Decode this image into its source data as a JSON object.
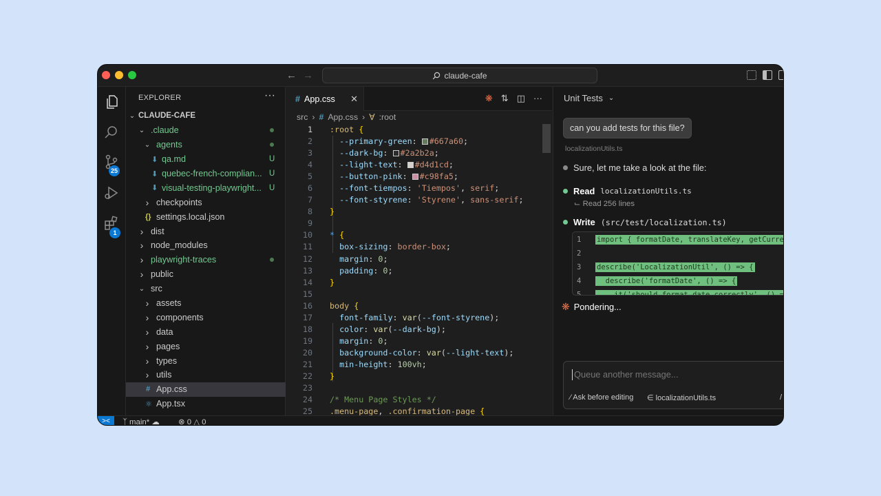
{
  "window": {
    "search_text": "claude-cafe"
  },
  "activity_bar": {
    "scm_badge": "25",
    "extensions_badge": "1"
  },
  "sidebar": {
    "title": "EXPLORER",
    "more": "···",
    "project": "CLAUDE-CAFE",
    "items": [
      {
        "label": ".claude",
        "indent": 1,
        "kind": "folder-open",
        "status": "dot",
        "color": "green"
      },
      {
        "label": "agents",
        "indent": 2,
        "kind": "folder-open",
        "status": "dot",
        "color": "green"
      },
      {
        "label": "qa.md",
        "indent": 3,
        "kind": "md",
        "status": "U",
        "color": "green"
      },
      {
        "label": "quebec-french-complian...",
        "indent": 3,
        "kind": "md",
        "status": "U",
        "color": "green"
      },
      {
        "label": "visual-testing-playwright...",
        "indent": 3,
        "kind": "md",
        "status": "U",
        "color": "green"
      },
      {
        "label": "checkpoints",
        "indent": 2,
        "kind": "folder",
        "status": "",
        "color": "normal"
      },
      {
        "label": "settings.local.json",
        "indent": 2,
        "kind": "json",
        "status": "",
        "color": "normal"
      },
      {
        "label": "dist",
        "indent": 1,
        "kind": "folder",
        "status": "",
        "color": "normal"
      },
      {
        "label": "node_modules",
        "indent": 1,
        "kind": "folder",
        "status": "",
        "color": "normal"
      },
      {
        "label": "playwright-traces",
        "indent": 1,
        "kind": "folder",
        "status": "dot",
        "color": "green"
      },
      {
        "label": "public",
        "indent": 1,
        "kind": "folder",
        "status": "",
        "color": "normal"
      },
      {
        "label": "src",
        "indent": 1,
        "kind": "folder-open",
        "status": "",
        "color": "normal"
      },
      {
        "label": "assets",
        "indent": 2,
        "kind": "folder",
        "status": "",
        "color": "normal"
      },
      {
        "label": "components",
        "indent": 2,
        "kind": "folder",
        "status": "",
        "color": "normal"
      },
      {
        "label": "data",
        "indent": 2,
        "kind": "folder",
        "status": "",
        "color": "normal"
      },
      {
        "label": "pages",
        "indent": 2,
        "kind": "folder",
        "status": "",
        "color": "normal"
      },
      {
        "label": "types",
        "indent": 2,
        "kind": "folder",
        "status": "",
        "color": "normal"
      },
      {
        "label": "utils",
        "indent": 2,
        "kind": "folder",
        "status": "",
        "color": "normal"
      },
      {
        "label": "App.css",
        "indent": 2,
        "kind": "css",
        "status": "",
        "color": "normal",
        "selected": true
      },
      {
        "label": "App.tsx",
        "indent": 2,
        "kind": "tsx",
        "status": "",
        "color": "normal"
      }
    ]
  },
  "editor": {
    "tab_label": "App.css",
    "breadcrumb": [
      "src",
      "App.css",
      ":root"
    ],
    "lines": [
      [
        [
          "sel-c",
          ":root "
        ],
        [
          "brace",
          "{"
        ]
      ],
      [
        [
          "",
          "  "
        ],
        [
          "prop",
          "--primary-green"
        ],
        [
          "",
          ": "
        ],
        [
          "swatch",
          "#667a60"
        ],
        [
          "val",
          "#667a60"
        ],
        [
          "",
          ";"
        ]
      ],
      [
        [
          "",
          "  "
        ],
        [
          "prop",
          "--dark-bg"
        ],
        [
          "",
          ": "
        ],
        [
          "swatch",
          "#2a2b2a"
        ],
        [
          "val",
          "#2a2b2a"
        ],
        [
          "",
          ";"
        ]
      ],
      [
        [
          "",
          "  "
        ],
        [
          "prop",
          "--light-text"
        ],
        [
          "",
          ": "
        ],
        [
          "swatch",
          "#d4d1cd"
        ],
        [
          "val",
          "#d4d1cd"
        ],
        [
          "",
          ";"
        ]
      ],
      [
        [
          "",
          "  "
        ],
        [
          "prop",
          "--button-pink"
        ],
        [
          "",
          ": "
        ],
        [
          "swatch",
          "#c98fa5"
        ],
        [
          "val",
          "#c98fa5"
        ],
        [
          "",
          ";"
        ]
      ],
      [
        [
          "",
          "  "
        ],
        [
          "prop",
          "--font-tiempos"
        ],
        [
          "",
          ": "
        ],
        [
          "val",
          "'Tiempos'"
        ],
        [
          "",
          ", "
        ],
        [
          "val",
          "serif"
        ],
        [
          "",
          ";"
        ]
      ],
      [
        [
          "",
          "  "
        ],
        [
          "prop",
          "--font-styrene"
        ],
        [
          "",
          ": "
        ],
        [
          "val",
          "'Styrene'"
        ],
        [
          "",
          ", "
        ],
        [
          "val",
          "sans-serif"
        ],
        [
          "",
          ";"
        ]
      ],
      [
        [
          "brace",
          "}"
        ]
      ],
      [],
      [
        [
          "kw",
          "* "
        ],
        [
          "brace",
          "{"
        ]
      ],
      [
        [
          "",
          "  "
        ],
        [
          "prop",
          "box-sizing"
        ],
        [
          "",
          ": "
        ],
        [
          "val",
          "border-box"
        ],
        [
          "",
          ";"
        ]
      ],
      [
        [
          "",
          "  "
        ],
        [
          "prop",
          "margin"
        ],
        [
          "",
          ": "
        ],
        [
          "num-c",
          "0"
        ],
        [
          "",
          ";"
        ]
      ],
      [
        [
          "",
          "  "
        ],
        [
          "prop",
          "padding"
        ],
        [
          "",
          ": "
        ],
        [
          "num-c",
          "0"
        ],
        [
          "",
          ";"
        ]
      ],
      [
        [
          "brace",
          "}"
        ]
      ],
      [],
      [
        [
          "sel-c",
          "body "
        ],
        [
          "brace",
          "{"
        ]
      ],
      [
        [
          "",
          "  "
        ],
        [
          "prop",
          "font-family"
        ],
        [
          "",
          ": "
        ],
        [
          "fn",
          "var"
        ],
        [
          "",
          "("
        ],
        [
          "prop",
          "--font-styrene"
        ],
        [
          "",
          ");"
        ]
      ],
      [
        [
          "",
          "  "
        ],
        [
          "prop",
          "color"
        ],
        [
          "",
          ": "
        ],
        [
          "fn",
          "var"
        ],
        [
          "",
          "("
        ],
        [
          "prop",
          "--dark-bg"
        ],
        [
          "",
          ");"
        ]
      ],
      [
        [
          "",
          "  "
        ],
        [
          "prop",
          "margin"
        ],
        [
          "",
          ": "
        ],
        [
          "num-c",
          "0"
        ],
        [
          "",
          ";"
        ]
      ],
      [
        [
          "",
          "  "
        ],
        [
          "prop",
          "background-color"
        ],
        [
          "",
          ": "
        ],
        [
          "fn",
          "var"
        ],
        [
          "",
          "("
        ],
        [
          "prop",
          "--light-text"
        ],
        [
          "",
          ");"
        ]
      ],
      [
        [
          "",
          "  "
        ],
        [
          "prop",
          "min-height"
        ],
        [
          "",
          ": "
        ],
        [
          "num-c",
          "100vh"
        ],
        [
          "",
          ";"
        ]
      ],
      [
        [
          "brace",
          "}"
        ]
      ],
      [],
      [
        [
          "cmt",
          "/* Menu Page Styles */"
        ]
      ],
      [
        [
          "sel-c",
          ".menu-page"
        ],
        [
          "",
          ", "
        ],
        [
          "sel-c",
          ".confirmation-page "
        ],
        [
          "brace",
          "{"
        ]
      ]
    ]
  },
  "panel": {
    "title": "Unit Tests",
    "user_message": "can you add tests for this file?",
    "context_file": "localizationUtils.ts",
    "reply": "Sure, let me take a look at the file:",
    "read_label": "Read",
    "read_file": "localizationUtils.ts",
    "read_result": "Read 256 lines",
    "write_label": "Write",
    "write_file": "(src/test/localization.ts)",
    "diff_lines": [
      {
        "n": "1",
        "t": "import { formatDate, translateKey, getCurrentLocale } from"
      },
      {
        "n": "2",
        "t": ""
      },
      {
        "n": "3",
        "t": "describe('LocalizationUtil', () => {"
      },
      {
        "n": "4",
        "t": "  describe('formatDate', () => {"
      },
      {
        "n": "5",
        "t": "    it('should format date correctly', () => {"
      }
    ],
    "status": "Pondering...",
    "input_placeholder": "Queue another message...",
    "option_edit": "Ask before editing",
    "option_file": "localizationUtils.ts",
    "option_slash": "/"
  },
  "statusbar": {
    "branch": "main*",
    "errors": "0",
    "warnings": "0"
  }
}
